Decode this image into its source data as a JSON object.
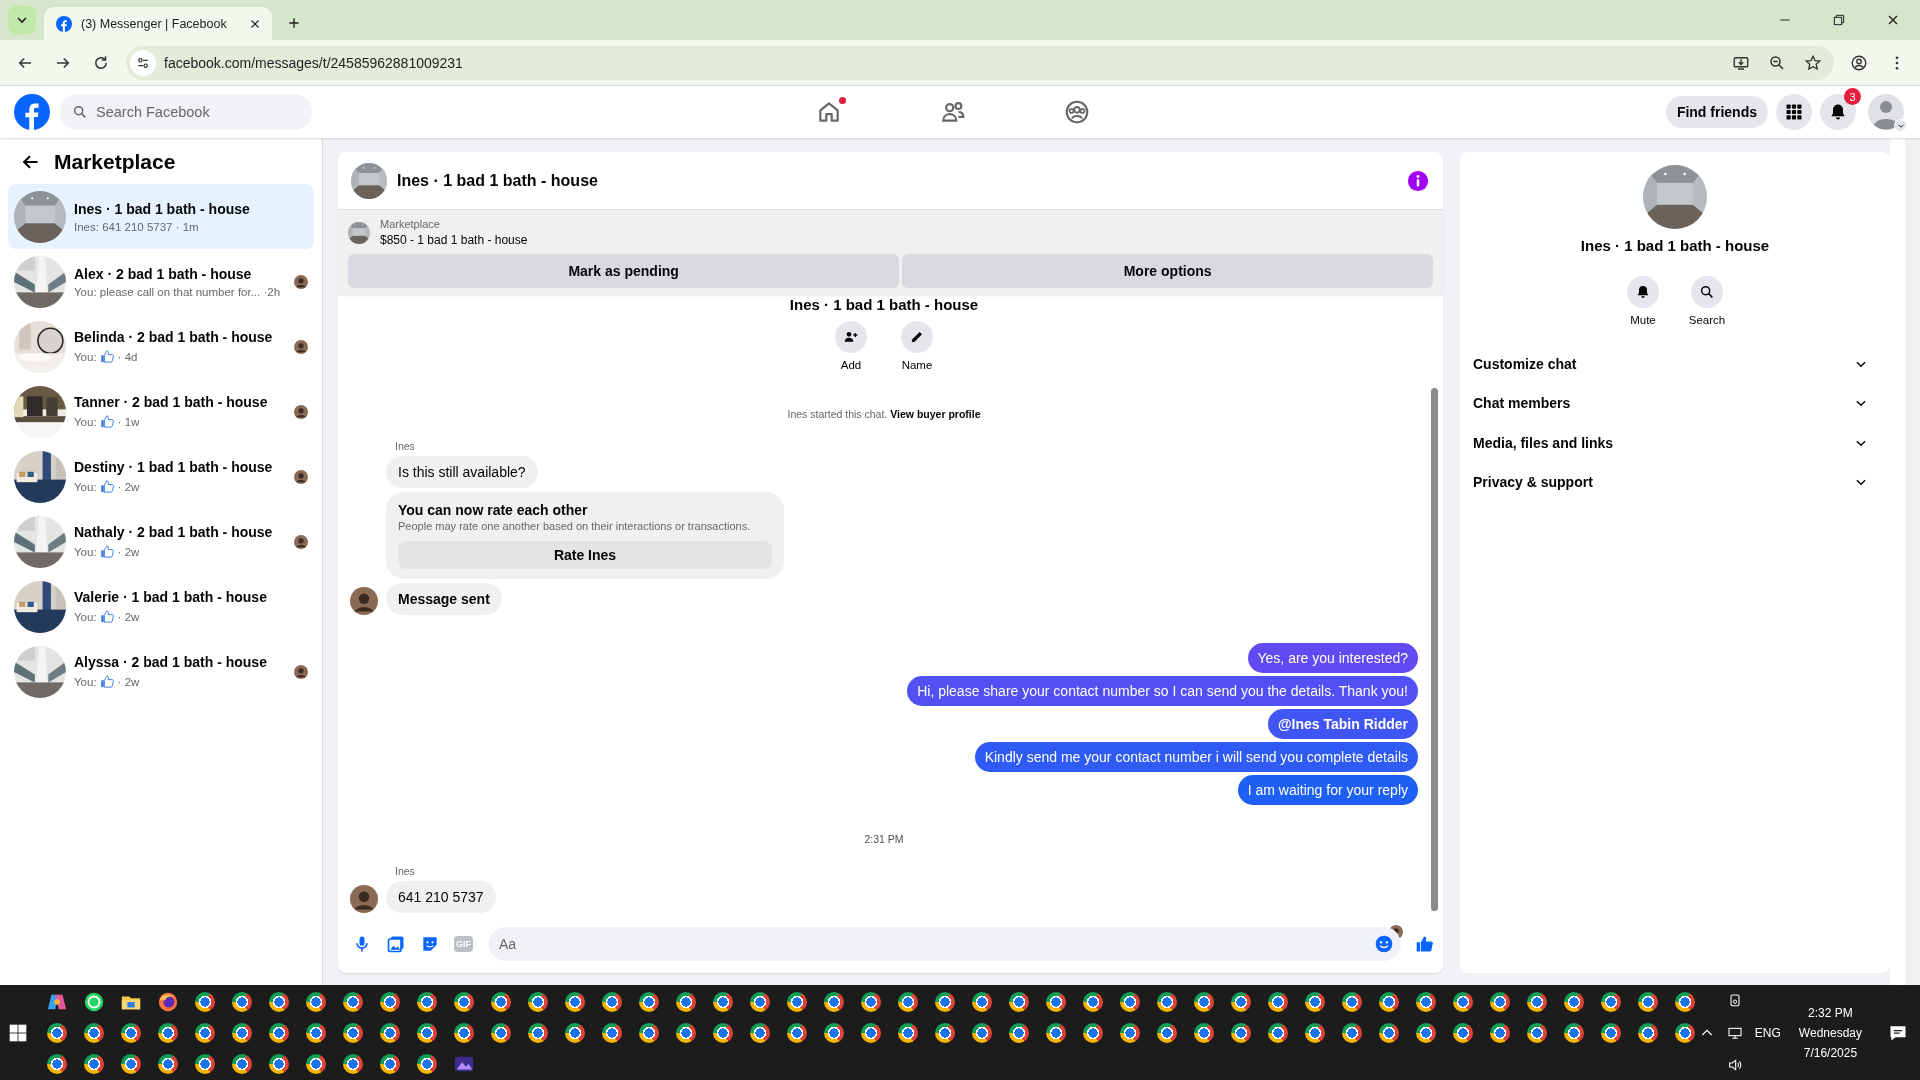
{
  "browser": {
    "tab_title": "(3) Messenger | Facebook",
    "url": "facebook.com/messages/t/24585962881009231"
  },
  "header": {
    "search": {
      "placeholder": "Search Facebook"
    },
    "nav": [
      {
        "kind": "home",
        "dot": true
      },
      {
        "kind": "friends",
        "dot": false
      },
      {
        "kind": "groups",
        "dot": false
      }
    ],
    "find_friends": "Find friends",
    "notification_count": "3"
  },
  "sidebar": {
    "title": "Marketplace",
    "conversations": [
      {
        "title": "Ines · 1 bad 1 bath - house",
        "kind": "text",
        "preview": "Ines: 641 210 5737 · 1m",
        "seen_avatar": false,
        "selected": true
      },
      {
        "title": "Alex · 2 bad 1 bath - house",
        "kind": "text",
        "preview": "You: please call on that number for... ·2h",
        "seen_avatar": true,
        "selected": false
      },
      {
        "title": "Belinda · 2 bad 1 bath - house",
        "kind": "like",
        "prefix": "You:",
        "time": "· 4d",
        "seen_avatar": true,
        "selected": false
      },
      {
        "title": "Tanner · 2 bad 1 bath - house",
        "kind": "like",
        "prefix": "You:",
        "time": "· 1w",
        "seen_avatar": true,
        "selected": false
      },
      {
        "title": "Destiny · 1 bad 1 bath - house",
        "kind": "like",
        "prefix": "You:",
        "time": "· 2w",
        "seen_avatar": true,
        "selected": false
      },
      {
        "title": "Nathaly · 2 bad 1 bath - house",
        "kind": "like",
        "prefix": "You:",
        "time": "· 2w",
        "seen_avatar": true,
        "selected": false
      },
      {
        "title": "Valerie · 1 bad 1 bath - house",
        "kind": "like",
        "prefix": "You:",
        "time": "· 2w",
        "seen_avatar": false,
        "selected": false
      },
      {
        "title": "Alyssa · 2 bad 1 bath - house",
        "kind": "like",
        "prefix": "You:",
        "time": "· 2w",
        "seen_avatar": true,
        "selected": false
      }
    ]
  },
  "chat": {
    "title": "Ines · 1 bad 1 bath - house",
    "listing": {
      "label": "Marketplace",
      "subtitle": "$850 - 1 bad 1 bath - house",
      "buttons": [
        "Mark as pending",
        "More options"
      ]
    },
    "intro_title": "Ines · 1 bad 1 bath - house",
    "intro_actions": [
      {
        "kind": "add",
        "label": "Add"
      },
      {
        "kind": "name",
        "label": "Name"
      }
    ],
    "system": {
      "text": "Ines started this chat.",
      "link": "View buyer profile"
    },
    "messages": [
      {
        "kind": "sender",
        "text": "Ines"
      },
      {
        "kind": "in",
        "text": "Is this still available?",
        "avatar": false,
        "bold": false
      },
      {
        "kind": "rate_card",
        "title": "You can now rate each other",
        "body": "People may rate one another based on their interactions or transactions.",
        "button": "Rate Ines"
      },
      {
        "kind": "in",
        "text": "Message sent",
        "avatar": true,
        "bold": true
      },
      {
        "kind": "out",
        "text": "Yes, are you interested?",
        "bold": false
      },
      {
        "kind": "out",
        "text": "Hi, please share your contact number so I can send you the details. Thank you!",
        "bold": false
      },
      {
        "kind": "out",
        "text": "@Ines Tabin Ridder",
        "bold": true
      },
      {
        "kind": "out",
        "text": "Kindly send me your contact number i will send you complete details",
        "bold": false
      },
      {
        "kind": "out",
        "text": "I am waiting for your reply",
        "bold": false
      },
      {
        "kind": "time",
        "text": "2:31 PM"
      },
      {
        "kind": "sender",
        "text": "Ines"
      },
      {
        "kind": "in",
        "text": "641 210 5737",
        "avatar": true,
        "bold": false
      }
    ],
    "seen_avatar": true,
    "composer": {
      "gif_label": "GIF",
      "placeholder": "Aa"
    }
  },
  "details": {
    "title": "Ines · 1 bad 1 bath - house",
    "actions": [
      {
        "kind": "mute",
        "label": "Mute"
      },
      {
        "kind": "search",
        "label": "Search"
      }
    ],
    "sections": [
      {
        "label": "Customize chat",
        "expanded": false
      },
      {
        "label": "Chat members",
        "expanded": false
      },
      {
        "label": "Media, files and links",
        "expanded": false
      },
      {
        "label": "Privacy & support",
        "expanded": false
      }
    ]
  },
  "taskbar": {
    "time": "2:32 PM",
    "day": "Wednesday",
    "date": "7/16/2025",
    "language": "ENG"
  }
}
